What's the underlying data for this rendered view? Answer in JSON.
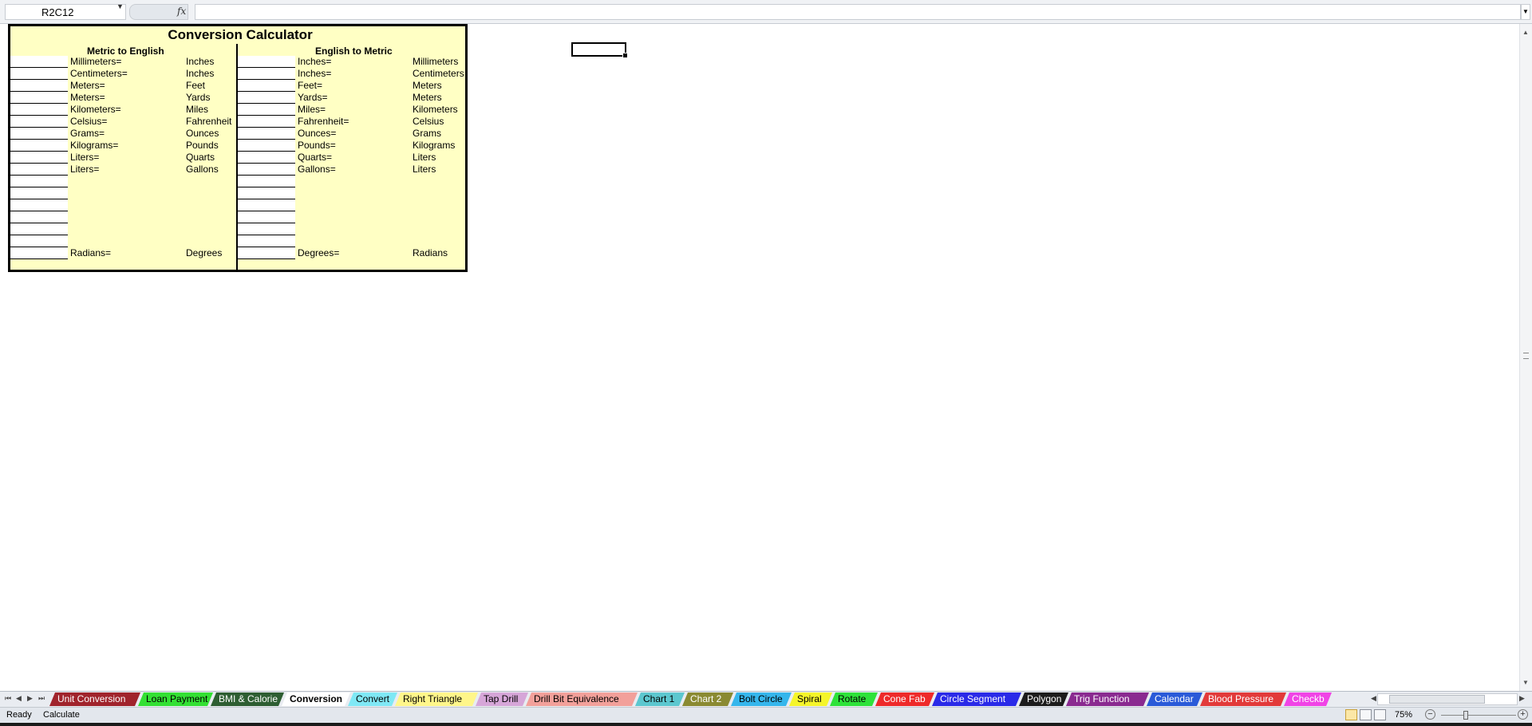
{
  "formula_bar": {
    "name_box": "R2C12",
    "formula": ""
  },
  "calculator": {
    "title": "Conversion Calculator",
    "metric_to_english": {
      "heading": "Metric to English",
      "rows": [
        {
          "from": "Millimeters=",
          "to": "Inches"
        },
        {
          "from": "Centimeters=",
          "to": "Inches"
        },
        {
          "from": "Meters=",
          "to": "Feet"
        },
        {
          "from": "Meters=",
          "to": "Yards"
        },
        {
          "from": "Kilometers=",
          "to": "Miles"
        },
        {
          "from": "Celsius=",
          "to": "Fahrenheit"
        },
        {
          "from": "Grams=",
          "to": "Ounces"
        },
        {
          "from": "Kilograms=",
          "to": "Pounds"
        },
        {
          "from": "Liters=",
          "to": "Quarts"
        },
        {
          "from": "Liters=",
          "to": "Gallons"
        }
      ],
      "last": {
        "from": "Radians=",
        "to": "Degrees"
      }
    },
    "english_to_metric": {
      "heading": "English to Metric",
      "rows": [
        {
          "from": "Inches=",
          "to": "Millimeters"
        },
        {
          "from": "Inches=",
          "to": "Centimeters"
        },
        {
          "from": "Feet=",
          "to": "Meters"
        },
        {
          "from": "Yards=",
          "to": "Meters"
        },
        {
          "from": "Miles=",
          "to": "Kilometers"
        },
        {
          "from": "Fahrenheit=",
          "to": "Celsius"
        },
        {
          "from": "Ounces=",
          "to": "Grams"
        },
        {
          "from": "Pounds=",
          "to": "Kilograms"
        },
        {
          "from": "Quarts=",
          "to": "Liters"
        },
        {
          "from": "Gallons=",
          "to": "Liters"
        }
      ],
      "last": {
        "from": "Degrees=",
        "to": "Radians"
      }
    }
  },
  "sheet_tabs": [
    {
      "label": "Unit Conversion",
      "color": "#a0242c",
      "text": "#ffffff"
    },
    {
      "label": "Loan Payment",
      "color": "#33e033",
      "text": "#000000"
    },
    {
      "label": "BMI & Calorie",
      "color": "#2e5e32",
      "text": "#ffffff"
    },
    {
      "label": "Conversion",
      "color": "#ffffff",
      "text": "#000000",
      "active": true
    },
    {
      "label": "Convert",
      "color": "#7fe8f5",
      "text": "#000000"
    },
    {
      "label": "Right Triangle",
      "color": "#fff68a",
      "text": "#000000"
    },
    {
      "label": "Tap Drill",
      "color": "#d6a6d8",
      "text": "#000000"
    },
    {
      "label": "Drill Bit Equivalence",
      "color": "#f2a09a",
      "text": "#000000"
    },
    {
      "label": "Chart 1",
      "color": "#5cc7cf",
      "text": "#000000"
    },
    {
      "label": "Chart 2",
      "color": "#8a8a32",
      "text": "#ffffff"
    },
    {
      "label": "Bolt Circle",
      "color": "#35b6ec",
      "text": "#000000"
    },
    {
      "label": "Spiral",
      "color": "#f5f52a",
      "text": "#000000"
    },
    {
      "label": "Rotate",
      "color": "#2ee23a",
      "text": "#000000"
    },
    {
      "label": "Cone Fab",
      "color": "#ee2a2a",
      "text": "#ffffff"
    },
    {
      "label": "Circle Segment",
      "color": "#2a2ae8",
      "text": "#ffffff"
    },
    {
      "label": "Polygon",
      "color": "#1c1c1c",
      "text": "#ffffff"
    },
    {
      "label": "Trig Function",
      "color": "#8a2a90",
      "text": "#ffffff"
    },
    {
      "label": "Calendar",
      "color": "#2a5ad8",
      "text": "#ffffff"
    },
    {
      "label": "Blood Pressure",
      "color": "#e23a3a",
      "text": "#ffffff"
    },
    {
      "label": "Checkb",
      "color": "#f044e6",
      "text": "#ffffff"
    }
  ],
  "status": {
    "ready": "Ready",
    "calculate": "Calculate",
    "zoom": "75%"
  }
}
